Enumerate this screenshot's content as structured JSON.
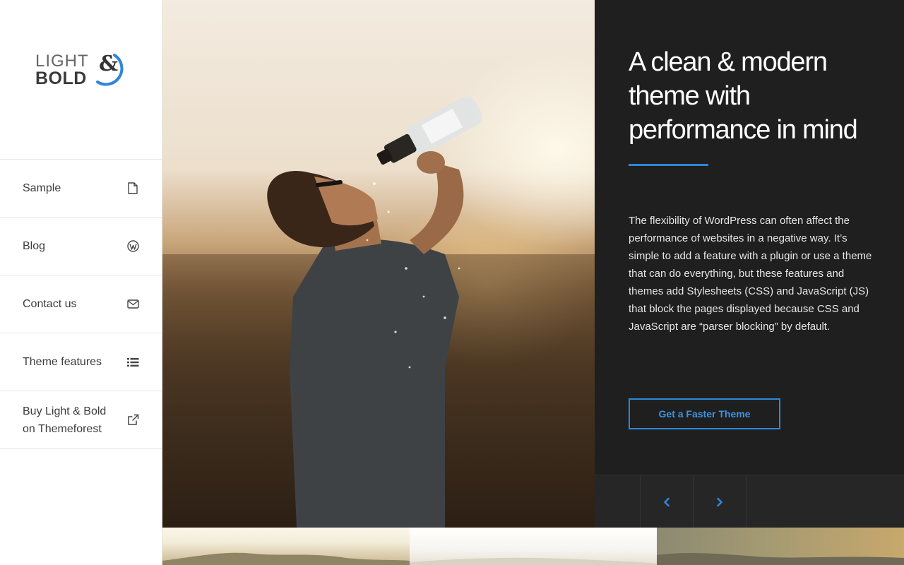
{
  "logo": {
    "light": "LIGHT",
    "bold": "BOLD",
    "amp": "&",
    "accent_color": "#2f86d6"
  },
  "menu": [
    {
      "label": "Sample",
      "icon": "file-icon"
    },
    {
      "label": "Blog",
      "icon": "wordpress-icon"
    },
    {
      "label": "Contact us",
      "icon": "envelope-icon"
    },
    {
      "label": "Theme features",
      "icon": "list-icon"
    },
    {
      "label": "Buy Light & Bold on Themeforest",
      "icon": "external-link-icon"
    }
  ],
  "hero": {
    "headline": "A clean & modern theme with performance in mind",
    "body": "The flexibility of WordPress can often affect the performance of websites in a negative way. It’s simple to add a feature with a plugin or use a theme that can do everything, but these features and themes add Stylesheets (CSS) and JavaScript (JS) that block the pages displayed because CSS and JavaScript are “parser blocking” by default.",
    "cta_label": "Get a Faster Theme"
  },
  "slider": {
    "prev_icon": "chevron-left-icon",
    "next_icon": "chevron-right-icon"
  },
  "colors": {
    "accent": "#2f86d6",
    "panel_bg": "#1f1f1f",
    "sidebar_bg": "#ffffff"
  }
}
